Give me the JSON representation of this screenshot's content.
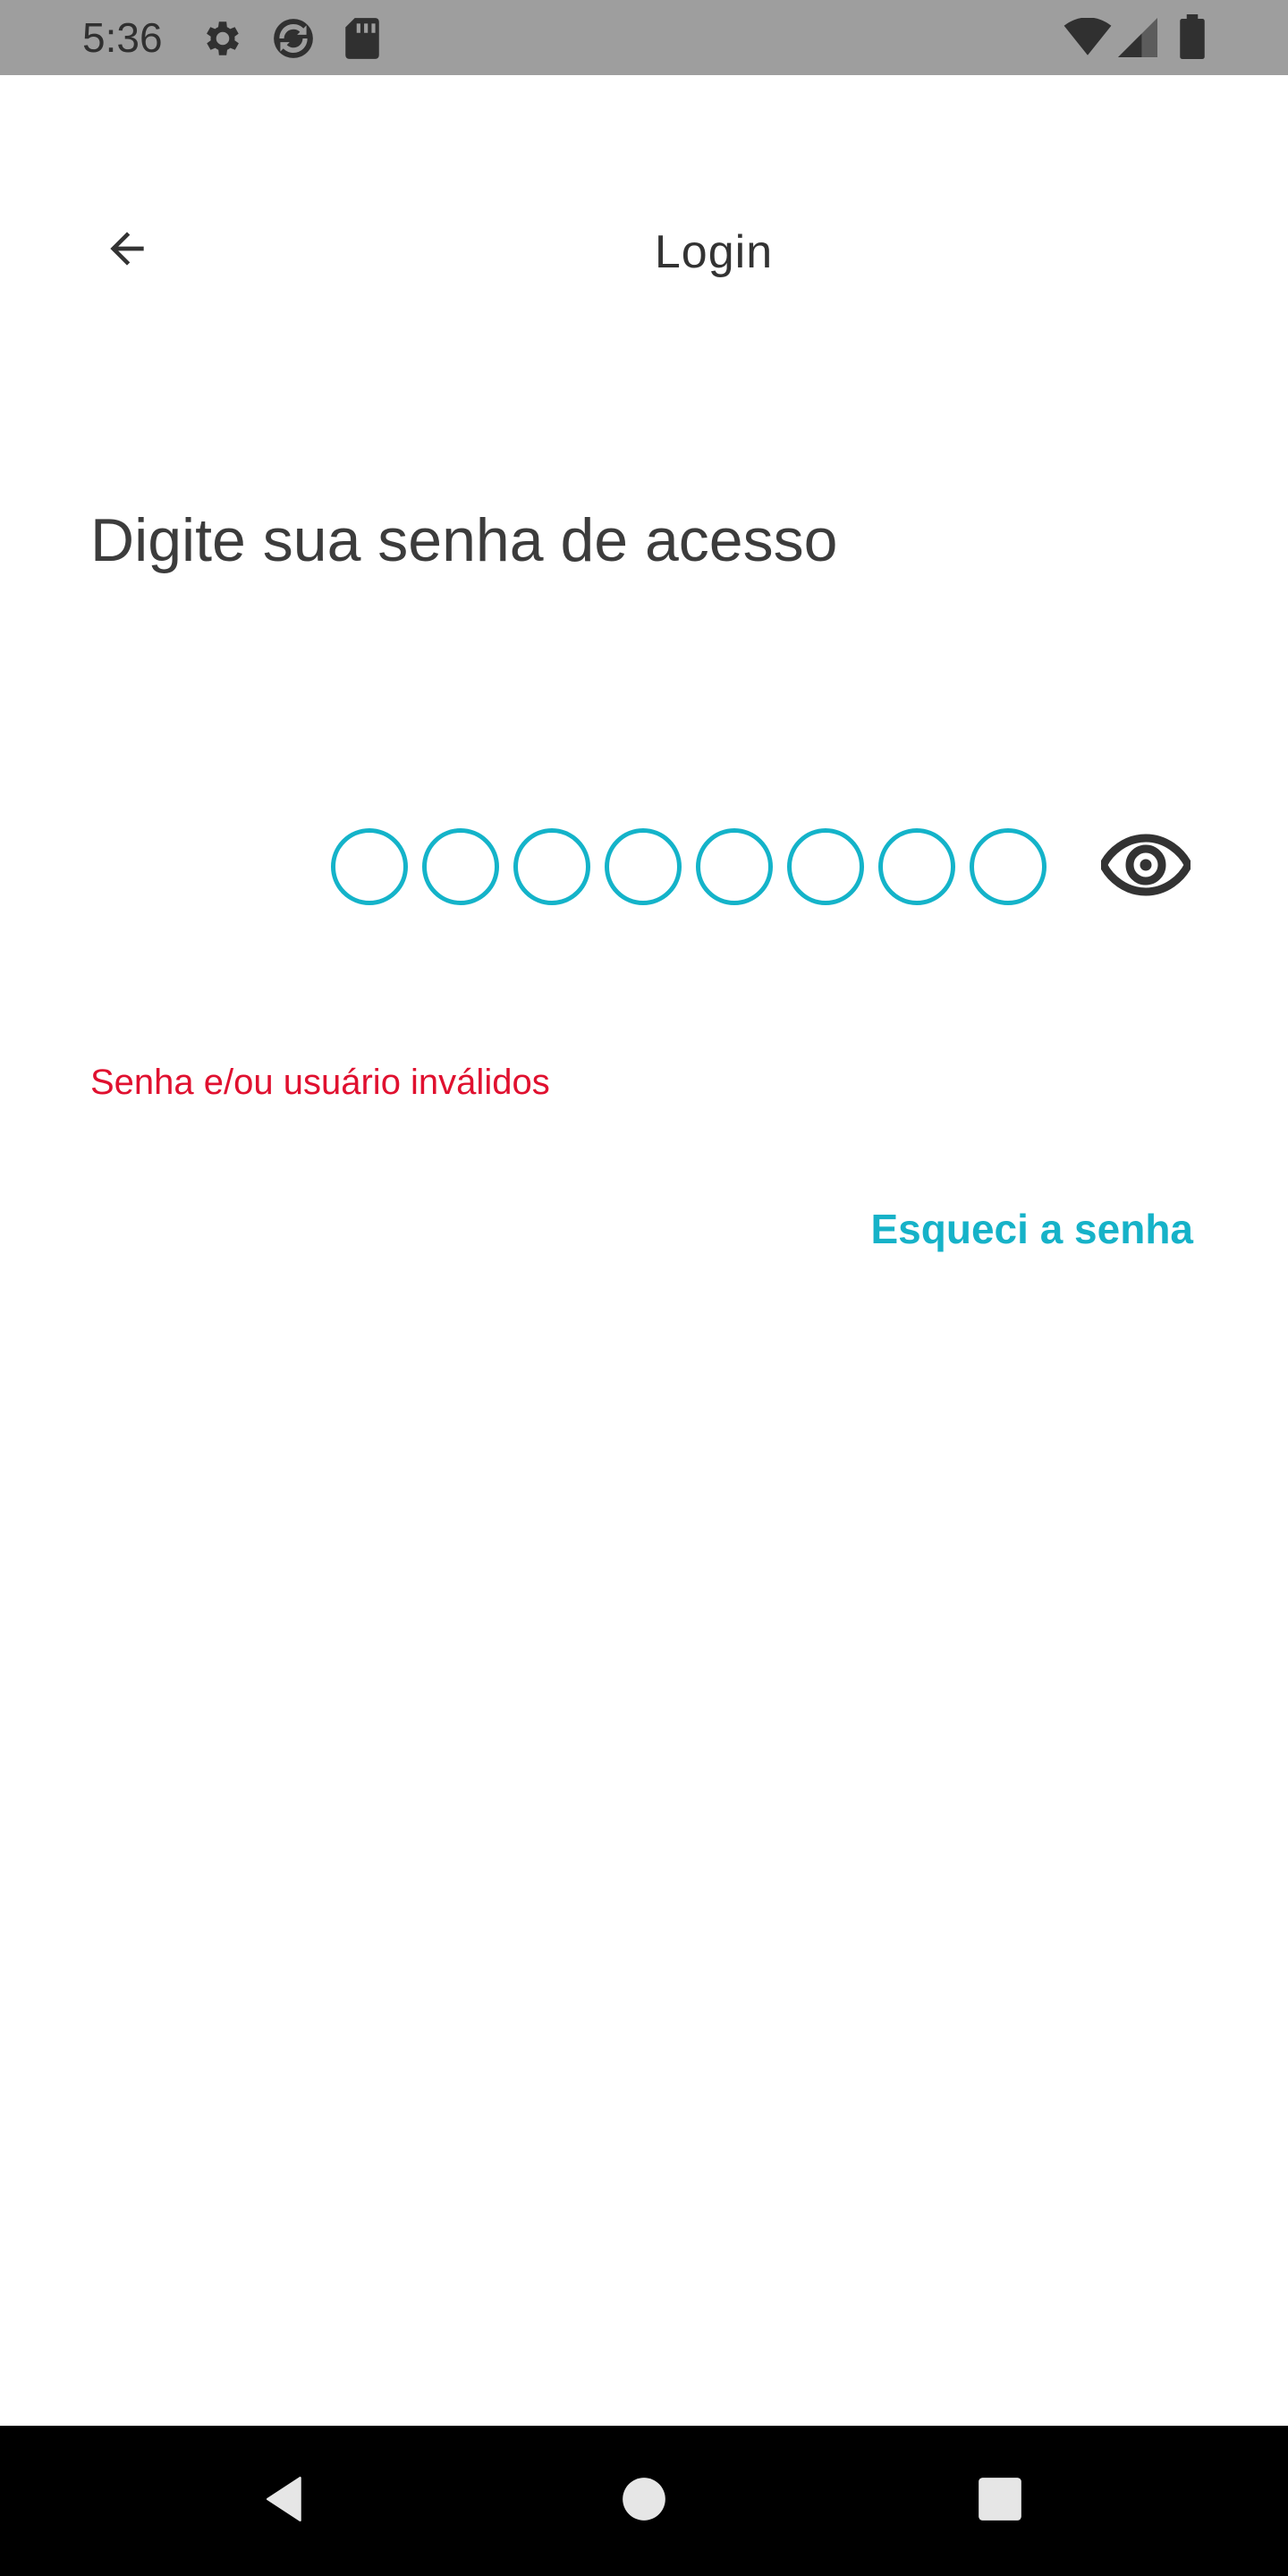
{
  "status_bar": {
    "time": "5:36",
    "left_icons": [
      "gear-icon",
      "sync-icon",
      "sd-card-icon"
    ],
    "right_icons": [
      "wifi-icon",
      "cell-signal-icon",
      "battery-icon"
    ]
  },
  "header": {
    "title": "Login",
    "back_icon": "arrow-left-icon"
  },
  "prompt": "Digite sua senha de acesso",
  "pin": {
    "length": 8,
    "filled": 0,
    "accent_color": "#14b3c9",
    "toggle_icon": "eye-icon"
  },
  "error": {
    "message": "Senha e/ou usuário inválidos",
    "color": "#e0102f"
  },
  "forgot_password": {
    "label": "Esqueci a senha",
    "color": "#16b2c8"
  },
  "nav_bar": {
    "buttons": [
      "back-triangle-icon",
      "home-circle-icon",
      "recents-square-icon"
    ]
  }
}
